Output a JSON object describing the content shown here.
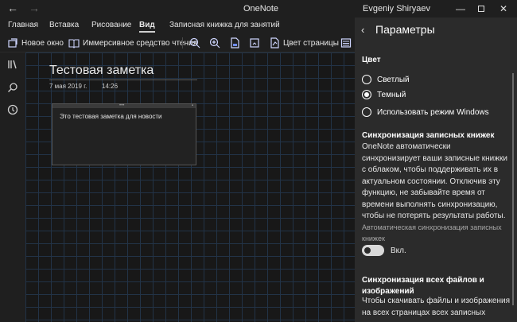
{
  "titlebar": {
    "back_icon": "back-arrow-icon",
    "forward_icon": "forward-arrow-icon",
    "app_title": "OneNote",
    "user_name": "Evgeniy Shiryaev",
    "window_controls": [
      "minimize-icon",
      "maximize-icon",
      "close-icon"
    ]
  },
  "ribbon": {
    "tabs": [
      {
        "label": "Главная"
      },
      {
        "label": "Вставка"
      },
      {
        "label": "Рисование"
      },
      {
        "label": "Вид",
        "active": true
      },
      {
        "label": "Записная книжка для занятий"
      }
    ],
    "toolbar": {
      "new_window": "Новое окно",
      "immersive_reader": "Иммерсивное средство чтения",
      "page_color": "Цвет страницы",
      "icons": [
        "new-window-icon",
        "immersive-reader-icon",
        "zoom-out-icon",
        "zoom-in-icon",
        "page-width-icon",
        "replay-icon",
        "page-color-icon",
        "rule-lines-icon"
      ]
    }
  },
  "rail": {
    "icons": [
      "notebooks-icon",
      "search-icon",
      "recent-icon"
    ]
  },
  "page": {
    "title": "Тестовая заметка",
    "date": "7 мая 2019 г.",
    "time": "14:26",
    "note_text": "Это тестовая заметка для новости"
  },
  "panel": {
    "title": "Параметры",
    "color_section": "Цвет",
    "options": [
      {
        "label": "Светлый",
        "selected": false
      },
      {
        "label": "Темный",
        "selected": true
      },
      {
        "label": "Использовать режим Windows",
        "selected": false
      }
    ],
    "sync_section": "Синхронизация записных книжек",
    "sync_text": "OneNote автоматически синхронизирует ваши записные книжки с облаком, чтобы поддерживать их в актуальном состоянии. Отключив эту функцию, не забывайте время от времени выполнять синхронизацию, чтобы не потерять результаты работы.",
    "auto_sync_label": "Автоматическая синхронизация записных книжек",
    "toggle_state": "Вкл.",
    "files_section": "Синхронизация всех файлов и изображений",
    "files_text": "Чтобы скачивать файлы и изображения на всех страницах всех записных"
  },
  "colors": {
    "background": "#1e1e1e",
    "panel": "#2b2b2b",
    "grid": "#223347"
  }
}
